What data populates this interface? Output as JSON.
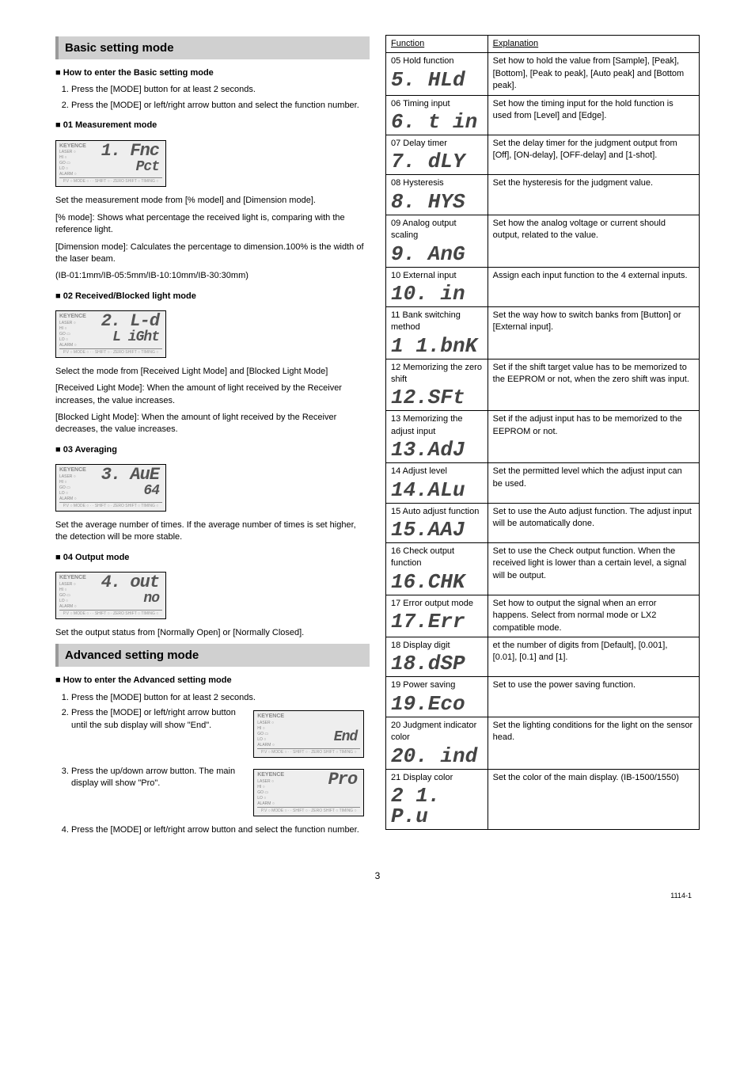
{
  "basic": {
    "title": "Basic setting mode",
    "howto_header": "How to enter the Basic setting mode",
    "howto_step1": "Press the [MODE] button for at least 2 seconds.",
    "howto_step2": "Press the [MODE] or left/right arrow button and select the function number.",
    "s01_header": "01 Measurement mode",
    "s01_seg1": "1.  Fnc",
    "s01_seg2": "Pct",
    "s01_p1": "Set the measurement mode from [% model] and [Dimension mode].",
    "s01_p2": "[% mode]: Shows what percentage the received light is, comparing with the reference light.",
    "s01_p3": "[Dimension mode]: Calculates the percentage to dimension.100% is the width of the laser beam.",
    "s01_p4": "(IB-01:1mm/IB-05:5mm/IB-10:10mm/IB-30:30mm)",
    "s02_header": "02 Received/Blocked light mode",
    "s02_seg1": "2.  L-d",
    "s02_seg2": "L iGht",
    "s02_p1": "Select the mode from [Received Light Mode] and [Blocked Light Mode]",
    "s02_p2": "[Received Light Mode]: When the amount of light received by the Receiver increases, the value increases.",
    "s02_p3": "[Blocked Light Mode]: When the amount of light received by the Receiver decreases, the value increases.",
    "s03_header": "03 Averaging",
    "s03_seg1": "3.  AuE",
    "s03_seg2": "64",
    "s03_p1": "Set the average number of times. If the average number of times is set higher, the detection will be more stable.",
    "s04_header": "04 Output mode",
    "s04_seg1": "4.  out",
    "s04_seg2": "no",
    "s04_p1": "Set the output status from [Normally Open] or [Normally Closed]."
  },
  "advanced": {
    "title": "Advanced setting mode",
    "howto_header": "How to enter the Advanced setting mode",
    "step1": "Press the [MODE] button for at least 2 seconds.",
    "step2": "Press the [MODE] or left/right arrow button until the sub display will show \"End\".",
    "step2_seg": "End",
    "step3": "Press the up/down arrow button. The main display will show \"Pro\".",
    "step3_seg": "Pro",
    "step4": "Press the [MODE] or left/right arrow button and select the function number."
  },
  "table": {
    "h1": "Function",
    "h2": "Explanation",
    "rows": [
      {
        "f": "05 Hold function",
        "seg": "5.  HLd",
        "e": "Set how to hold the value from [Sample], [Peak], [Bottom], [Peak to peak], [Auto peak] and [Bottom peak]."
      },
      {
        "f": "06 Timing input",
        "seg": "6.  t in",
        "e": "Set how the timing input for the hold function is used from [Level] and [Edge]."
      },
      {
        "f": "07 Delay timer",
        "seg": "7.  dLY",
        "e": "Set the delay timer for the judgment output from [Off], [ON-delay], [OFF-delay] and [1-shot]."
      },
      {
        "f": "08 Hysteresis",
        "seg": "8.  HYS",
        "e": "Set the hysteresis for the judgment value."
      },
      {
        "f": "09 Analog output scaling",
        "seg": "9.  AnG",
        "e": "Set how the analog voltage or current should output, related to the value."
      },
      {
        "f": "10 External input",
        "seg": "10.   in",
        "e": "Assign each input function to the 4 external inputs."
      },
      {
        "f": "11 Bank switching method",
        "seg": "1 1.bnK",
        "e": "Set the way how to switch banks from [Button]   or [External input]."
      },
      {
        "f": "12 Memorizing the zero shift",
        "seg": "12.SFt",
        "e": "Set if the shift target value has to be memorized to the EEPROM or not, when the zero shift was input."
      },
      {
        "f": "13 Memorizing the adjust input",
        "seg": "13.AdJ",
        "e": "Set if the adjust input has to be memorized to the EEPROM or not."
      },
      {
        "f": "14 Adjust level",
        "seg": "14.ALu",
        "e": "Set the permitted level which the adjust input can be used."
      },
      {
        "f": "15 Auto adjust function",
        "seg": "15.AAJ",
        "e": "Set to use the Auto adjust function. The adjust input will be automatically done."
      },
      {
        "f": "16 Check output function",
        "seg": "16.CHK",
        "e": "Set to use the Check output function. When the received light is lower than a certain level, a signal will be output."
      },
      {
        "f": "17 Error output mode",
        "seg": "17.Err",
        "e": "Set how to output the signal when an error happens. Select from normal mode or LX2 compatible mode."
      },
      {
        "f": "18 Display digit",
        "seg": "18.dSP",
        "e": "et the number of digits from [Default], [0.001], [0.01], [0.1] and [1]."
      },
      {
        "f": "19 Power saving",
        "seg": "19.Eco",
        "e": "Set to use the power saving function."
      },
      {
        "f": "20 Judgment indicator color",
        "seg": "20. ind",
        "e": "Set the lighting conditions for the light on the sensor head."
      },
      {
        "f": "21 Display color",
        "seg": "2 1. P.u",
        "e": "Set the color of the main display. (IB-1500/1550)"
      }
    ]
  },
  "footer": {
    "page": "3",
    "code": "1114-1"
  }
}
